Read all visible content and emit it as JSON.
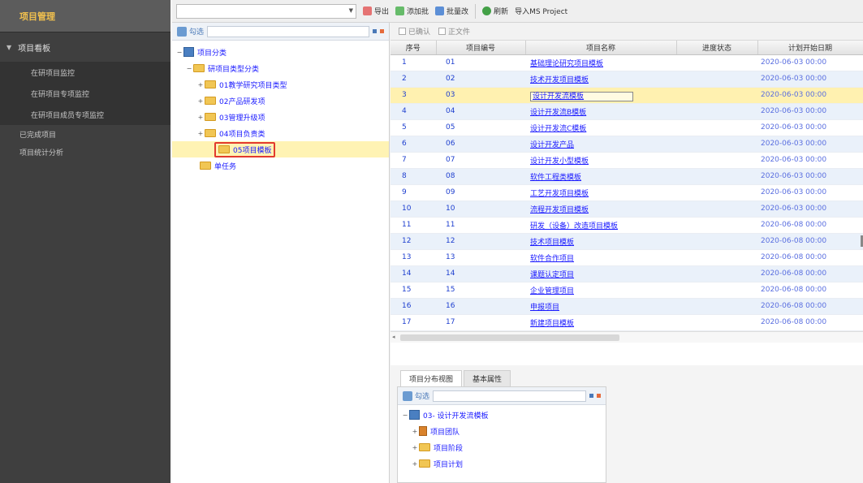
{
  "sidebar": {
    "header": "项目管理",
    "section": "项目看板",
    "sub_items": [
      "在研项目监控",
      "在研项目专项监控",
      "在研项目成员专项监控"
    ],
    "extra_items": [
      "已完成项目",
      "项目统计分析"
    ]
  },
  "toolbar": {
    "combo_value": "",
    "buttons": [
      "导出",
      "添加批",
      "批量改",
      "刷新",
      "导入MS Project"
    ]
  },
  "tree_panel": {
    "search_label": "勾选",
    "search_placeholder": "",
    "nodes": [
      {
        "label": "项目分类",
        "level": 0,
        "kind": "project",
        "toggle": "−"
      },
      {
        "label": "研项目类型分类",
        "level": 1,
        "kind": "folder",
        "toggle": "−"
      },
      {
        "label": "01教学研究项目类型",
        "level": 2,
        "kind": "folder",
        "toggle": "+"
      },
      {
        "label": "02产品研发项",
        "level": 2,
        "kind": "folder",
        "toggle": "+"
      },
      {
        "label": "03管理升级项",
        "level": 2,
        "kind": "folder",
        "toggle": "+"
      },
      {
        "label": "04项目负责类",
        "level": 2,
        "kind": "folder",
        "toggle": "+"
      },
      {
        "label": "05项目模板",
        "level": 2,
        "kind": "folder",
        "toggle": "",
        "selected": true
      },
      {
        "label": "单任务",
        "level": 1,
        "kind": "folder",
        "toggle": ""
      }
    ]
  },
  "grid": {
    "toggles": [
      "已确认",
      "正文件"
    ],
    "columns": [
      "序号",
      "项目编号",
      "项目名称",
      "进度状态",
      "计划开始日期"
    ],
    "rows": [
      {
        "no": "1",
        "code": "01",
        "name": "基础理论研究项目模板",
        "status": "",
        "date": "2020-06-03 00:00"
      },
      {
        "no": "2",
        "code": "02",
        "name": "技术开发项目模板",
        "status": "",
        "date": "2020-06-03 00:00"
      },
      {
        "no": "3",
        "code": "03",
        "name": "设计开发流模板",
        "status": "",
        "date": "2020-06-03 00:00"
      },
      {
        "no": "4",
        "code": "04",
        "name": "设计开发流B模板",
        "status": "",
        "date": "2020-06-03 00:00"
      },
      {
        "no": "5",
        "code": "05",
        "name": "设计开发流C模板",
        "status": "",
        "date": "2020-06-03 00:00"
      },
      {
        "no": "6",
        "code": "06",
        "name": "设计开发产品",
        "status": "",
        "date": "2020-06-03 00:00"
      },
      {
        "no": "7",
        "code": "07",
        "name": "设计开发小型模板",
        "status": "",
        "date": "2020-06-03 00:00"
      },
      {
        "no": "8",
        "code": "08",
        "name": "软件工程类模板",
        "status": "",
        "date": "2020-06-03 00:00"
      },
      {
        "no": "9",
        "code": "09",
        "name": "工艺开发项目模板",
        "status": "",
        "date": "2020-06-03 00:00"
      },
      {
        "no": "10",
        "code": "10",
        "name": "流程开发项目模板",
        "status": "",
        "date": "2020-06-03 00:00"
      },
      {
        "no": "11",
        "code": "11",
        "name": "研发（设备）改造项目模板",
        "status": "",
        "date": "2020-06-08 00:00"
      },
      {
        "no": "12",
        "code": "12",
        "name": "技术项目模板",
        "status": "",
        "date": "2020-06-08 00:00"
      },
      {
        "no": "13",
        "code": "13",
        "name": "软件合作项目",
        "status": "",
        "date": "2020-06-08 00:00"
      },
      {
        "no": "14",
        "code": "14",
        "name": "课题认定项目",
        "status": "",
        "date": "2020-06-08 00:00"
      },
      {
        "no": "15",
        "code": "15",
        "name": "企业管理项目",
        "status": "",
        "date": "2020-06-08 00:00"
      },
      {
        "no": "16",
        "code": "16",
        "name": "申报项目",
        "status": "",
        "date": "2020-06-08 00:00"
      },
      {
        "no": "17",
        "code": "17",
        "name": "新建项目模板",
        "status": "",
        "date": "2020-06-08 00:00"
      }
    ]
  },
  "bottom": {
    "tabs": [
      "项目分布视图",
      "基本属性"
    ],
    "search_label": "勾选",
    "nodes": [
      {
        "label": "03- 设计开发流模板",
        "level": 0,
        "kind": "project",
        "toggle": "−"
      },
      {
        "label": "项目团队",
        "level": 1,
        "kind": "team",
        "toggle": "+"
      },
      {
        "label": "项目阶段",
        "level": 1,
        "kind": "folder",
        "toggle": "+"
      },
      {
        "label": "项目计划",
        "level": 1,
        "kind": "folder",
        "toggle": "+"
      }
    ]
  },
  "colors": {
    "sidebar_bg": "#3f3f3f",
    "sidebar_header_text": "#f2c14e",
    "link_blue": "#1a1aff",
    "selection_yellow": "#fff1b0",
    "highlight_red": "#e23a2e"
  }
}
